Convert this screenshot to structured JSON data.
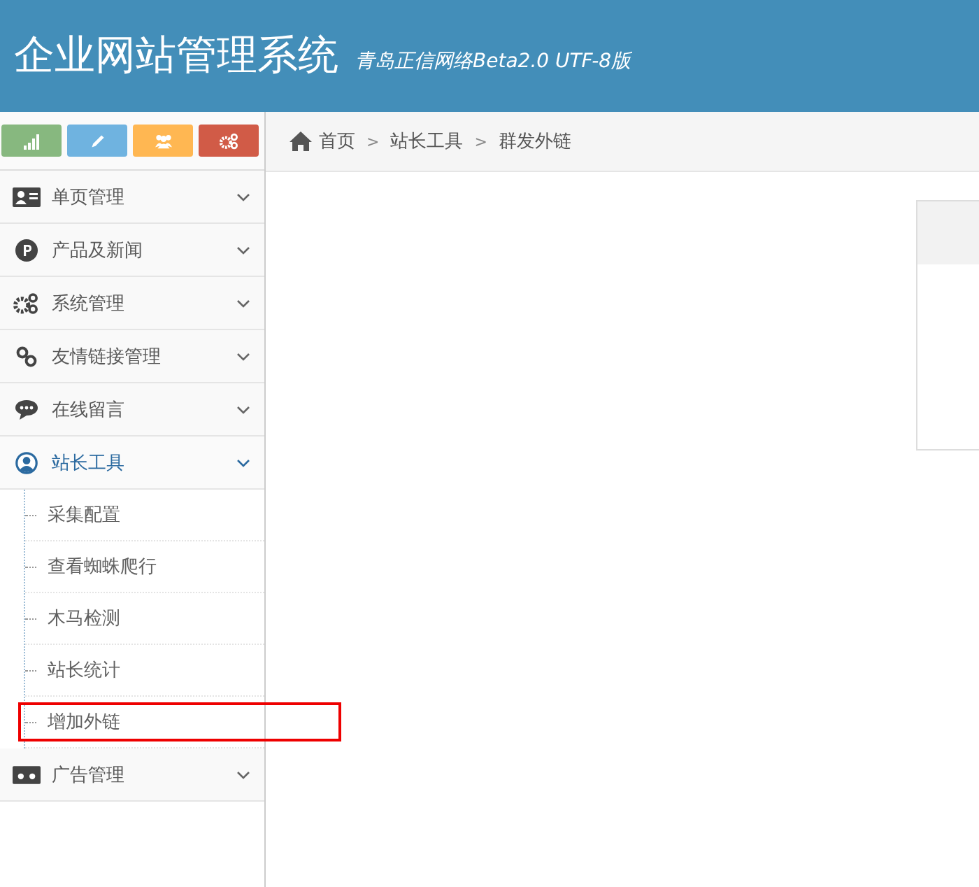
{
  "header": {
    "title": "企业网站管理系统",
    "subtitle": "青岛正信网络Beta2.0 UTF-8版"
  },
  "shortcuts": [
    {
      "kind": "signal",
      "color": "#87b87f"
    },
    {
      "kind": "pencil",
      "color": "#6fb3e0"
    },
    {
      "kind": "users",
      "color": "#ffb752"
    },
    {
      "kind": "cogs",
      "color": "#d15b47"
    }
  ],
  "menu": [
    {
      "kind": "card",
      "label": "单页管理",
      "expanded": false
    },
    {
      "kind": "p-circle",
      "label": "产品及新闻",
      "expanded": false
    },
    {
      "kind": "cogs",
      "label": "系统管理",
      "expanded": false
    },
    {
      "kind": "link",
      "label": "友情链接管理",
      "expanded": false
    },
    {
      "kind": "chat",
      "label": "在线留言",
      "expanded": false
    },
    {
      "kind": "user",
      "label": "站长工具",
      "expanded": true,
      "children": [
        {
          "label": "采集配置",
          "highlighted": false
        },
        {
          "label": "查看蜘蛛爬行",
          "highlighted": false
        },
        {
          "label": "木马检测",
          "highlighted": false
        },
        {
          "label": "站长统计",
          "highlighted": false
        },
        {
          "label": "增加外链",
          "highlighted": true
        }
      ]
    },
    {
      "kind": "ad",
      "label": "广告管理",
      "expanded": false
    }
  ],
  "breadcrumb": [
    {
      "kind": "link",
      "text": "首页"
    },
    {
      "kind": "separator",
      "text": ">"
    },
    {
      "kind": "link",
      "text": "站长工具"
    },
    {
      "kind": "separator",
      "text": ">"
    },
    {
      "kind": "link",
      "text": "群发外链"
    }
  ]
}
